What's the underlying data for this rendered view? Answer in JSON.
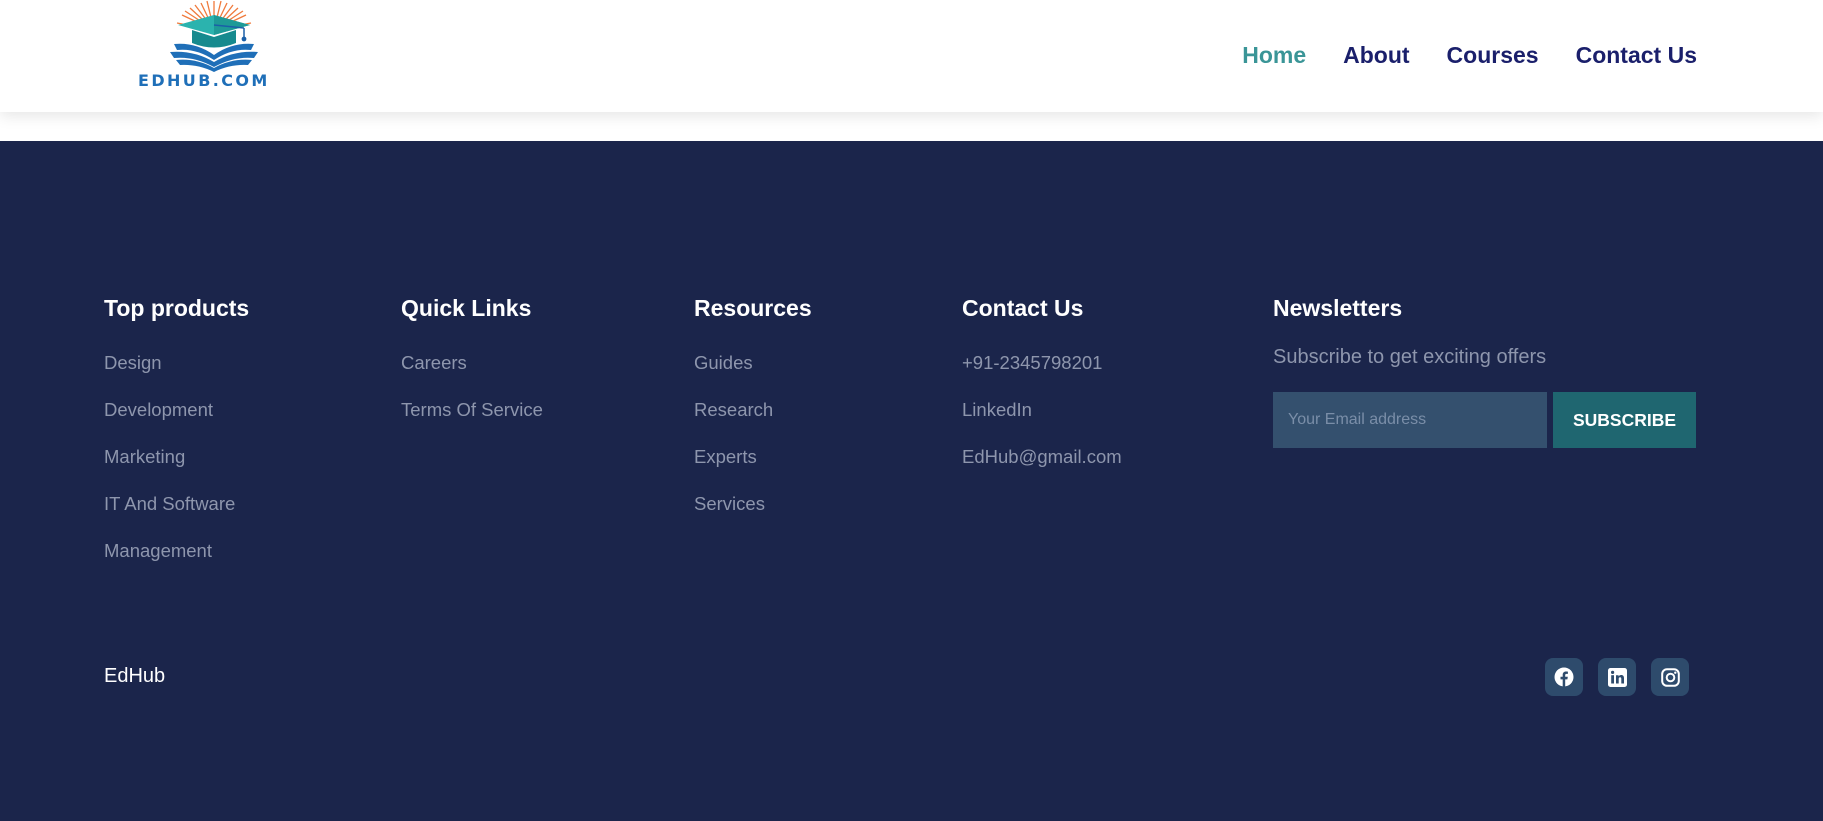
{
  "header": {
    "logo_text": "EDHUB.COM",
    "nav": [
      {
        "label": "Home",
        "active": true
      },
      {
        "label": "About"
      },
      {
        "label": "Courses"
      },
      {
        "label": "Contact Us"
      }
    ]
  },
  "footer": {
    "columns": [
      {
        "title": "Top products",
        "items": [
          "Design",
          "Development",
          "Marketing",
          "IT And Software",
          "Management"
        ]
      },
      {
        "title": "Quick Links",
        "items": [
          "Careers",
          "Terms Of Service"
        ]
      },
      {
        "title": "Resources",
        "items": [
          "Guides",
          "Research",
          "Experts",
          "Services"
        ]
      },
      {
        "title": "Contact Us",
        "items": [
          "+91-2345798201",
          "LinkedIn",
          "EdHub@gmail.com"
        ]
      }
    ],
    "newsletter": {
      "title": "Newsletters",
      "subtitle": "Subscribe to get exciting offers",
      "email_placeholder": "Your Email address",
      "email_value": "",
      "button_label": "SUBSCRIBE"
    },
    "brand": "EdHub",
    "social": [
      "facebook-icon",
      "linkedin-icon",
      "instagram-icon"
    ]
  },
  "colors": {
    "footer_bg": "#1b254b",
    "nav_text": "#1a1f6b",
    "nav_active": "#3a9597",
    "button_bg": "#1f6670",
    "input_bg": "#34506e",
    "social_bg": "#2e4b6c",
    "link_muted": "#8e96ad"
  }
}
